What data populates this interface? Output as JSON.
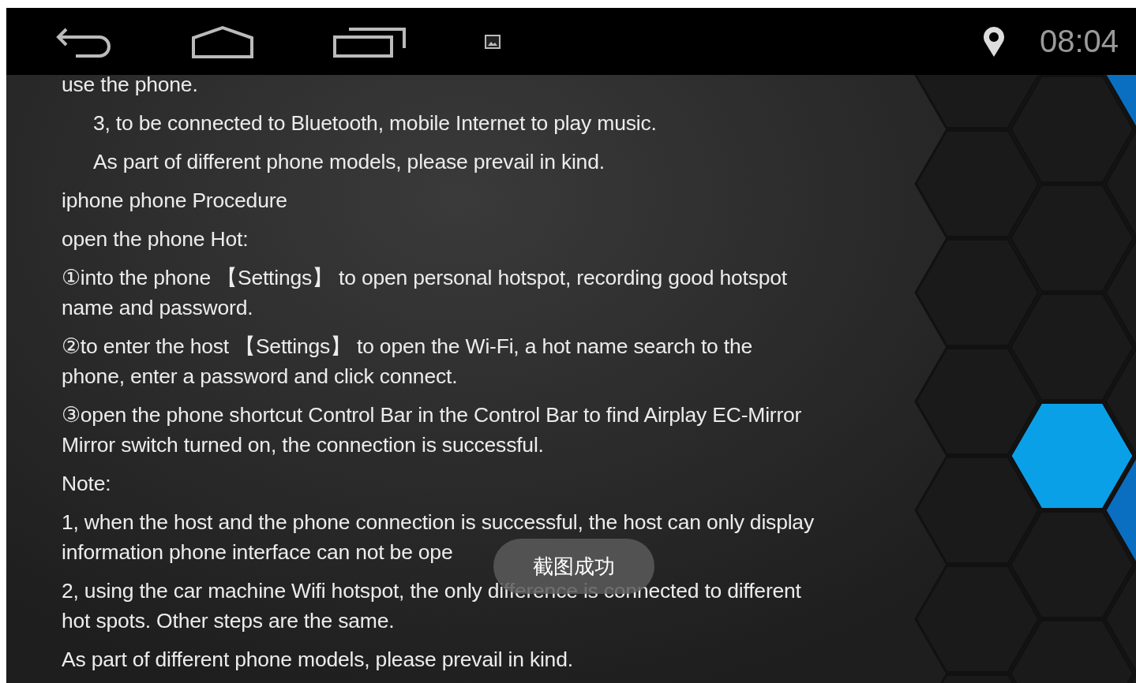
{
  "status_bar": {
    "time": "08:04"
  },
  "paragraphs": [
    {
      "kind": "plain",
      "lines": [
        "use the phone."
      ]
    },
    {
      "kind": "indented",
      "lines": [
        "3, to be connected to Bluetooth, mobile Internet to play music."
      ]
    },
    {
      "kind": "indented",
      "lines": [
        "As part of different phone models, please prevail in kind."
      ]
    },
    {
      "kind": "plain",
      "lines": [
        "iphone phone Procedure"
      ]
    },
    {
      "kind": "plain",
      "lines": [
        "open the phone Hot:"
      ]
    },
    {
      "kind": "plain",
      "lines": [
        "①into the phone 【Settings】 to open personal hotspot, recording good hotspot",
        "name and password."
      ]
    },
    {
      "kind": "plain",
      "lines": [
        "②to enter the host 【Settings】 to open the Wi-Fi, a hot name search to the",
        "phone, enter a password and click connect."
      ]
    },
    {
      "kind": "plain",
      "lines": [
        "③open the phone shortcut Control Bar in the Control Bar to find Airplay EC-Mirror",
        "Mirror switch turned on, the connection is successful."
      ]
    },
    {
      "kind": "plain",
      "lines": [
        "Note:"
      ]
    },
    {
      "kind": "plain",
      "lines": [
        "1, when the host and the phone connection is successful, the host can only display",
        "information phone interface can not be ope"
      ]
    },
    {
      "kind": "plain",
      "lines": [
        "2, using the car machine Wifi hotspot, the only difference is connected to different",
        "hot spots. Other steps are the same."
      ]
    },
    {
      "kind": "plain",
      "lines": [
        "As part of different phone models, please prevail in kind."
      ]
    }
  ],
  "toast": "截图成功"
}
